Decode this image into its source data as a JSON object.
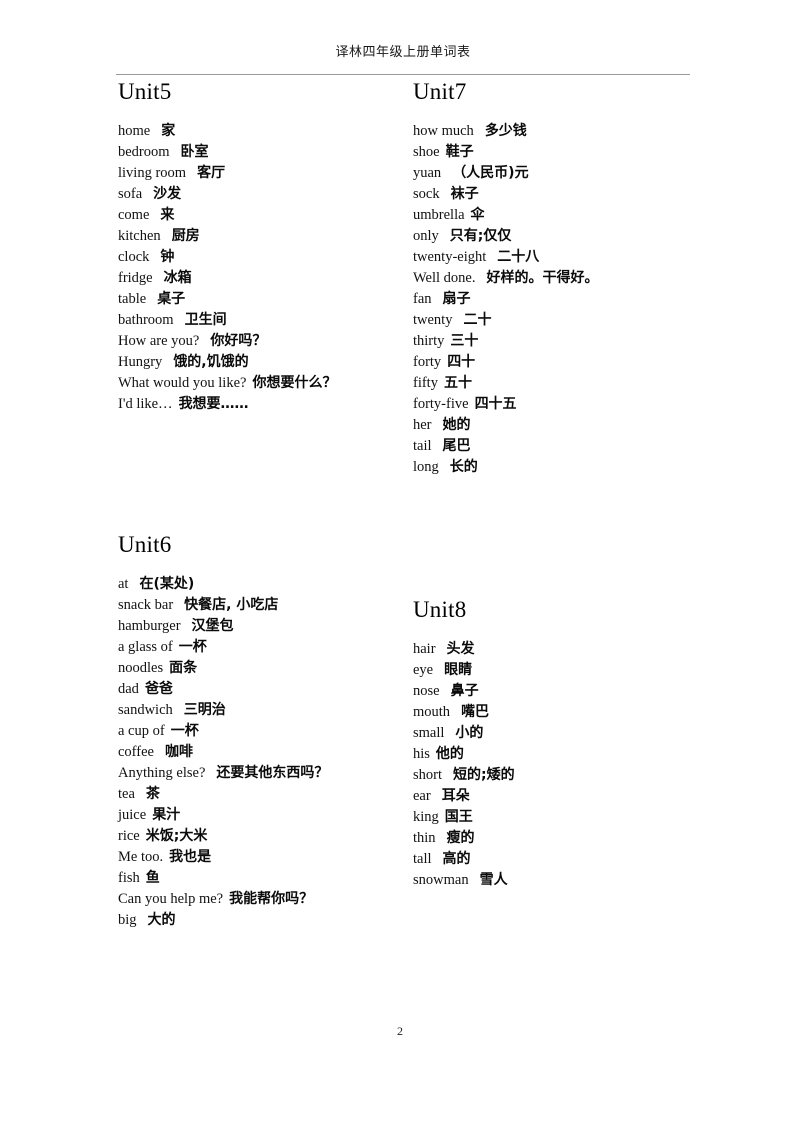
{
  "document": {
    "header_title": "译林四年级上册单词表",
    "page_number": "2"
  },
  "units": {
    "unit5": {
      "title": "Unit5",
      "entries": [
        {
          "en": "home",
          "zh": "家",
          "gap": "md"
        },
        {
          "en": "bedroom",
          "zh": "卧室",
          "gap": "md"
        },
        {
          "en": "living room",
          "zh": "客厅",
          "gap": "md"
        },
        {
          "en": "sofa",
          "zh": "沙发",
          "gap": "md"
        },
        {
          "en": "come",
          "zh": "来",
          "gap": "md"
        },
        {
          "en": "kitchen",
          "zh": "厨房",
          "gap": "md"
        },
        {
          "en": "clock",
          "zh": "钟",
          "gap": "md"
        },
        {
          "en": "fridge",
          "zh": "冰箱",
          "gap": "md"
        },
        {
          "en": "table",
          "zh": "桌子",
          "gap": "md"
        },
        {
          "en": "bathroom",
          "zh": "卫生间",
          "gap": "md"
        },
        {
          "en": "How are you?",
          "zh": "你好吗？",
          "gap": "md"
        },
        {
          "en": "Hungry",
          "zh": "饿的,饥饿的",
          "gap": "md"
        },
        {
          "en": "What would you like?",
          "zh": "你想要什么？",
          "gap": "sm"
        },
        {
          "en": "I'd like…",
          "zh": "我想要……",
          "gap": "sm"
        }
      ]
    },
    "unit6": {
      "title": "Unit6",
      "entries": [
        {
          "en": "at",
          "zh": "在(某处)",
          "gap": "md"
        },
        {
          "en": "snack bar",
          "zh": "快餐店, 小吃店",
          "gap": "md"
        },
        {
          "en": "hamburger",
          "zh": "汉堡包",
          "gap": "md"
        },
        {
          "en": "a glass of",
          "zh": "一杯",
          "gap": "sm"
        },
        {
          "en": "noodles",
          "zh": "面条",
          "gap": "sm"
        },
        {
          "en": "dad",
          "zh": "爸爸",
          "gap": "sm"
        },
        {
          "en": "sandwich",
          "zh": "三明治",
          "gap": "md"
        },
        {
          "en": "a cup of",
          "zh": "一杯",
          "gap": "sm"
        },
        {
          "en": "coffee",
          "zh": "咖啡",
          "gap": "md"
        },
        {
          "en": "Anything else?",
          "zh": "还要其他东西吗？",
          "gap": "md"
        },
        {
          "en": "tea",
          "zh": "茶",
          "gap": "md"
        },
        {
          "en": "juice",
          "zh": "果汁",
          "gap": "sm"
        },
        {
          "en": "rice",
          "zh": "米饭;大米",
          "gap": "sm"
        },
        {
          "en": "Me too.",
          "zh": "我也是",
          "gap": "sm"
        },
        {
          "en": "fish",
          "zh": "鱼",
          "gap": "sm"
        },
        {
          "en": "Can you help me?",
          "zh": "我能帮你吗？",
          "gap": "sm"
        },
        {
          "en": "big",
          "zh": "大的",
          "gap": "md"
        }
      ]
    },
    "unit7": {
      "title": "Unit7",
      "entries": [
        {
          "en": "how much",
          "zh": "多少钱",
          "gap": "md"
        },
        {
          "en": "shoe",
          "zh": "鞋子",
          "gap": "sm"
        },
        {
          "en": "yuan",
          "zh": "（人民币)元",
          "gap": "md"
        },
        {
          "en": "sock",
          "zh": "袜子",
          "gap": "md"
        },
        {
          "en": "umbrella",
          "zh": "伞",
          "gap": "sm"
        },
        {
          "en": "only",
          "zh": "只有;仅仅",
          "gap": "md"
        },
        {
          "en": "twenty-eight",
          "zh": "二十八",
          "gap": "md"
        },
        {
          "en": "Well done.",
          "zh": "好样的。干得好。",
          "gap": "md"
        },
        {
          "en": "fan",
          "zh": "扇子",
          "gap": "md"
        },
        {
          "en": "twenty",
          "zh": "二十",
          "gap": "md"
        },
        {
          "en": "thirty",
          "zh": "三十",
          "gap": "sm"
        },
        {
          "en": "forty",
          "zh": "四十",
          "gap": "sm"
        },
        {
          "en": "fifty",
          "zh": "五十",
          "gap": "sm"
        },
        {
          "en": "forty-five",
          "zh": "四十五",
          "gap": "sm"
        },
        {
          "en": "her",
          "zh": "她的",
          "gap": "md"
        },
        {
          "en": "tail",
          "zh": "尾巴",
          "gap": "md"
        },
        {
          "en": "long",
          "zh": "长的",
          "gap": "md"
        }
      ]
    },
    "unit8": {
      "title": "Unit8",
      "entries": [
        {
          "en": "hair",
          "zh": "头发",
          "gap": "md"
        },
        {
          "en": "eye",
          "zh": "眼睛",
          "gap": "md"
        },
        {
          "en": "nose",
          "zh": "鼻子",
          "gap": "md"
        },
        {
          "en": "mouth",
          "zh": "嘴巴",
          "gap": "md"
        },
        {
          "en": "small",
          "zh": "小的",
          "gap": "md"
        },
        {
          "en": "his",
          "zh": "他的",
          "gap": "sm"
        },
        {
          "en": "short",
          "zh": "短的;矮的",
          "gap": "md"
        },
        {
          "en": "ear",
          "zh": "耳朵",
          "gap": "md"
        },
        {
          "en": "king",
          "zh": "国王",
          "gap": "sm"
        },
        {
          "en": "thin",
          "zh": "瘦的",
          "gap": "md"
        },
        {
          "en": "tall",
          "zh": "高的",
          "gap": "md"
        },
        {
          "en": "snowman",
          "zh": "雪人",
          "gap": "md"
        }
      ]
    }
  }
}
